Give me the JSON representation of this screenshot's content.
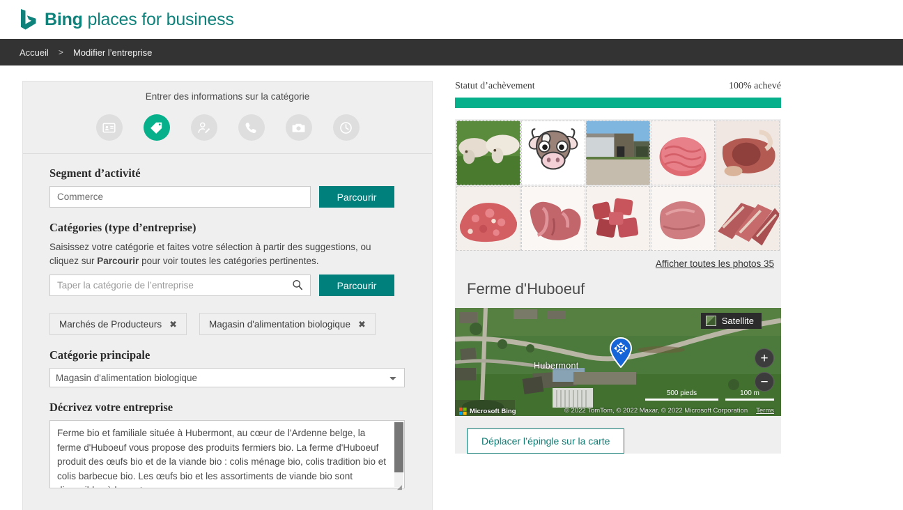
{
  "header": {
    "brand_bold": "Bing",
    "brand_light": " places for business",
    "logo_icon": "bing-b-logo"
  },
  "breadcrumb": {
    "home": "Accueil",
    "separator": ">",
    "current": "Modifier l’entreprise"
  },
  "form": {
    "step_title": "Entrer des informations sur la catégorie",
    "steps": [
      {
        "name": "business-card-icon",
        "active": false
      },
      {
        "name": "tag-icon",
        "active": true
      },
      {
        "name": "person-edit-icon",
        "active": false
      },
      {
        "name": "phone-icon",
        "active": false
      },
      {
        "name": "camera-icon",
        "active": false
      },
      {
        "name": "clock-icon",
        "active": false
      }
    ],
    "segment_label": "Segment d’activité",
    "segment_value": "Commerce",
    "segment_browse": "Parcourir",
    "categories_label": "Catégories (type d’entreprise)",
    "categories_help_part1": "Saisissez votre catégorie et faites votre sélection à partir des suggestions, ou cliquez sur ",
    "categories_help_bold": "Parcourir",
    "categories_help_part2": " pour voir toutes les catégories pertinentes.",
    "category_placeholder": "Taper la catégorie de l’entreprise",
    "category_value": "",
    "category_browse": "Parcourir",
    "chips": [
      {
        "label": "Marchés de Producteurs",
        "remove": "✖"
      },
      {
        "label": "Magasin d'alimentation biologique",
        "remove": "✖"
      }
    ],
    "main_category_label": "Catégorie principale",
    "main_category_value": "Magasin d'alimentation biologique",
    "describe_label": "Décrivez votre entreprise",
    "describe_value": "Ferme bio et familiale située à Hubermont, au cœur de l'Ardenne belge, la ferme d'Huboeuf vous propose des produits fermiers bio. La ferme d'Huboeuf produit des œufs bio et de la viande bio : colis ménage bio, colis tradition bio et colis barbecue bio. Les œufs bio et les assortiments de viande bio sont disponibles à la vente..."
  },
  "preview": {
    "status_label": "Statut d’achèvement",
    "status_value": "100% achevé",
    "progress_percent": 100,
    "photos": [
      {
        "alt": "cows-grazing-photo"
      },
      {
        "alt": "cow-cartoon-logo"
      },
      {
        "alt": "farm-buildings-photo"
      },
      {
        "alt": "ground-beef-photo"
      },
      {
        "alt": "beef-rib-chop-photo"
      },
      {
        "alt": "minced-meat-photo"
      },
      {
        "alt": "beef-tongue-photo"
      },
      {
        "alt": "beef-cubes-photo"
      },
      {
        "alt": "beef-roast-photo"
      },
      {
        "alt": "beef-ribs-photo"
      }
    ],
    "all_photos_link": "Afficher toutes les photos 35",
    "business_name": "Ferme d'Huboeuf",
    "map": {
      "satellite_label": "Satellite",
      "place_label": "Hubermont",
      "zoom_in": "+",
      "zoom_out": "−",
      "scale_imperial": "500 pieds",
      "scale_metric": "100 m",
      "provider": "Microsoft Bing",
      "attribution": "© 2022 TomTom, © 2022 Maxar, © 2022 Microsoft Corporation",
      "terms": "Terms"
    },
    "move_pin_button": "Déplacer l’épingle sur la carte"
  },
  "colors": {
    "brand_teal": "#10827c",
    "accent_green": "#06b08b",
    "button_teal": "#00807d",
    "panel_bg": "#efefef",
    "crumb_bar": "#333333"
  }
}
